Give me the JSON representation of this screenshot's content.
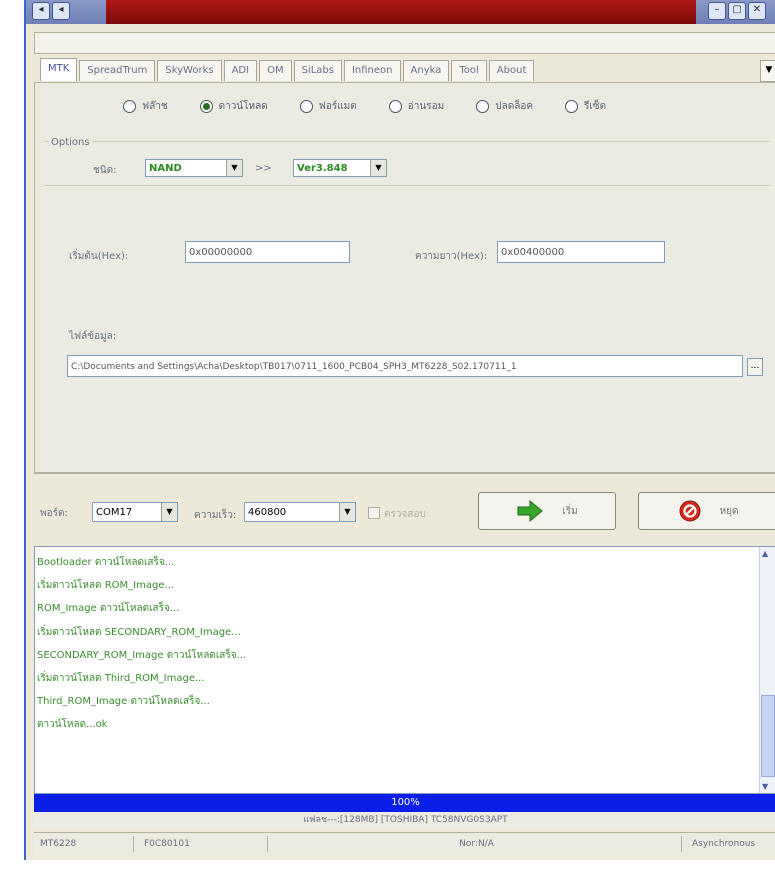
{
  "tabs": [
    "MTK",
    "SpreadTrum",
    "SkyWorks",
    "ADI",
    "OM",
    "SiLabs",
    "Infineon",
    "Anyka",
    "Tool",
    "About"
  ],
  "radios": [
    {
      "label": "ฟล๊าช",
      "checked": false
    },
    {
      "label": "ดาวน์โหลด",
      "checked": true
    },
    {
      "label": "ฟอร์แมต",
      "checked": false
    },
    {
      "label": "อ่านรอม",
      "checked": false
    },
    {
      "label": "ปลดล็อค",
      "checked": false
    },
    {
      "label": "รีเซ็ต",
      "checked": false
    }
  ],
  "options": {
    "legend": "Options",
    "type_label": "ชนิด:",
    "type_value": "NAND",
    "arrows": ">>",
    "version_value": "Ver3.848"
  },
  "address": {
    "start_label": "เริ่มต้น(Hex):",
    "start_value": "0x00000000",
    "length_label": "ความยาว(Hex):",
    "length_value": "0x00400000"
  },
  "file": {
    "label": "ไฟล์ข้อมูล:",
    "path": "C:\\Documents and Settings\\Acha\\Desktop\\TB017\\0711_1600_PCB04_SPH3_MT6228_S02.170711_1"
  },
  "controls": {
    "port_label": "พอร์ต:",
    "port_value": "COM17",
    "baud_label": "ความเร็ว:",
    "baud_value": "460800",
    "check_label": "ตรวจสอบ",
    "start_button": "เริ่ม",
    "stop_button": "หยุด"
  },
  "log": [
    "Bootloader ดาวน์โหลดเสร็จ...",
    "เริ่มดาวน์โหลด ROM_Image...",
    "ROM_Image ดาวน์โหลดเสร็จ...",
    "เริ่มดาวน์โหลด SECONDARY_ROM_Image...",
    "SECONDARY_ROM_Image ดาวน์โหลดเสร็จ...",
    "เริ่มดาวน์โหลด Third_ROM_Image...",
    "Third_ROM_Image ดาวน์โหลดเสร็จ...",
    "ดาวน์โหลด...ok"
  ],
  "progress": {
    "percent": 100,
    "label": "100%"
  },
  "info": "แฟลช---:[128MB] [TOSHIBA] TC58NVG0S3APT",
  "status": {
    "chip": "MT6228",
    "id": "F0C80101",
    "nor": "Nor:N/A",
    "mode": "Asynchronous"
  },
  "colors": {
    "accent": "#0b1ee8",
    "log_text": "#3a8c2e",
    "title_red": "#b01818"
  }
}
